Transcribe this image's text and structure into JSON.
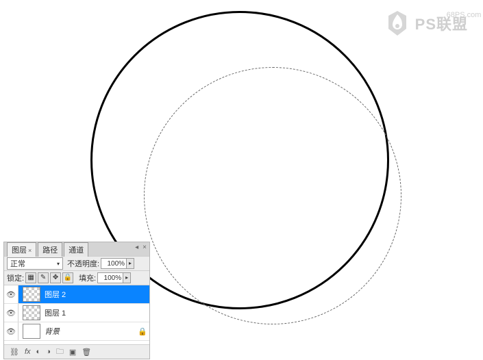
{
  "watermark": {
    "url": "68PS.com",
    "text": "PS联盟"
  },
  "panel": {
    "tabs": {
      "layers": "图层",
      "paths": "路径",
      "channels": "通道"
    },
    "blend_mode": "正常",
    "opacity_label": "不透明度:",
    "opacity_value": "100%",
    "lock_label": "锁定:",
    "fill_label": "填充:",
    "fill_value": "100%",
    "layers": [
      {
        "name": "图层 2"
      },
      {
        "name": "图层 1"
      },
      {
        "name": "背景"
      }
    ]
  }
}
